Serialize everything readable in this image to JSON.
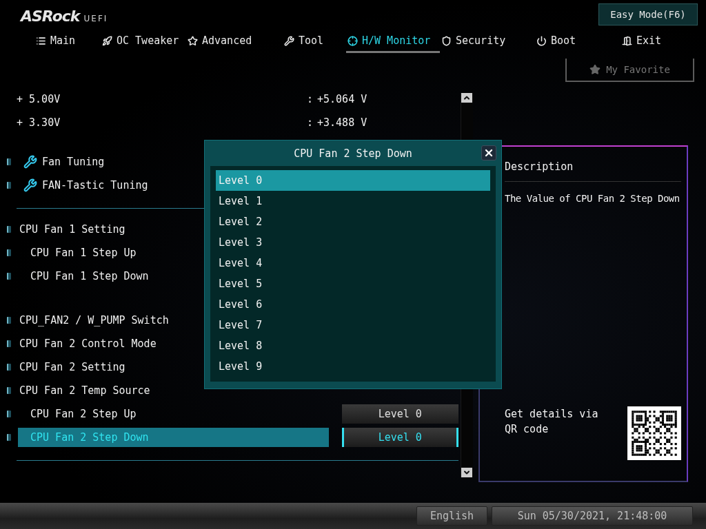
{
  "header": {
    "logo": "ASRock",
    "logo_suffix": "UEFI",
    "easy_mode": "Easy Mode(F6)"
  },
  "tabs": [
    {
      "label": "Main",
      "selected": false
    },
    {
      "label": "OC Tweaker",
      "selected": false
    },
    {
      "label": "Advanced",
      "selected": false
    },
    {
      "label": "Tool",
      "selected": false
    },
    {
      "label": "H/W Monitor",
      "selected": true
    },
    {
      "label": "Security",
      "selected": false
    },
    {
      "label": "Boot",
      "selected": false
    },
    {
      "label": "Exit",
      "selected": false
    }
  ],
  "favorite": "My Favorite",
  "voltages": [
    {
      "label": "+ 5.00V",
      "separator": ":",
      "value": "+5.064 V"
    },
    {
      "label": "+ 3.30V",
      "separator": ":",
      "value": "+3.488 V"
    }
  ],
  "sections": [
    {
      "divider_after": true,
      "items": [
        {
          "kind": "tool",
          "label": "Fan Tuning",
          "selected": false
        },
        {
          "kind": "tool",
          "label": "FAN-Tastic Tuning",
          "selected": false
        }
      ]
    },
    {
      "divider_after": false,
      "items": [
        {
          "kind": "setting",
          "label": "CPU Fan 1 Setting",
          "selected": false,
          "children": [
            {
              "kind": "setting",
              "label": "CPU Fan 1 Step Up",
              "selected": false
            },
            {
              "kind": "setting",
              "label": "CPU Fan 1 Step Down",
              "selected": false
            }
          ]
        }
      ]
    },
    {
      "divider_after": true,
      "items": [
        {
          "kind": "setting",
          "label": "CPU_FAN2 / W_PUMP Switch",
          "selected": false
        },
        {
          "kind": "setting",
          "label": "CPU Fan 2 Control Mode",
          "selected": false
        },
        {
          "kind": "setting",
          "label": "CPU Fan 2 Setting",
          "selected": false
        },
        {
          "kind": "setting",
          "label": "CPU Fan 2 Temp Source",
          "selected": false,
          "children": [
            {
              "kind": "setting",
              "label": "CPU Fan 2 Step Up",
              "selected": false,
              "value": "Level 0"
            },
            {
              "kind": "setting",
              "label": "CPU Fan 2 Step Down",
              "selected": true,
              "value": "Level 0"
            }
          ]
        }
      ]
    }
  ],
  "description": {
    "title": "Description",
    "text": "The Value of CPU Fan 2 Step Down",
    "qr_caption": "Get details via QR code"
  },
  "dialog": {
    "title": "CPU Fan 2 Step Down",
    "options": [
      {
        "label": "Level 0",
        "selected": true
      },
      {
        "label": "Level 1",
        "selected": false
      },
      {
        "label": "Level 2",
        "selected": false
      },
      {
        "label": "Level 3",
        "selected": false
      },
      {
        "label": "Level 4",
        "selected": false
      },
      {
        "label": "Level 5",
        "selected": false
      },
      {
        "label": "Level 6",
        "selected": false
      },
      {
        "label": "Level 7",
        "selected": false
      },
      {
        "label": "Level 8",
        "selected": false
      },
      {
        "label": "Level 9",
        "selected": false
      }
    ]
  },
  "status_bar": {
    "language": "English",
    "datetime": "Sun 05/30/2021, 21:48:00"
  }
}
